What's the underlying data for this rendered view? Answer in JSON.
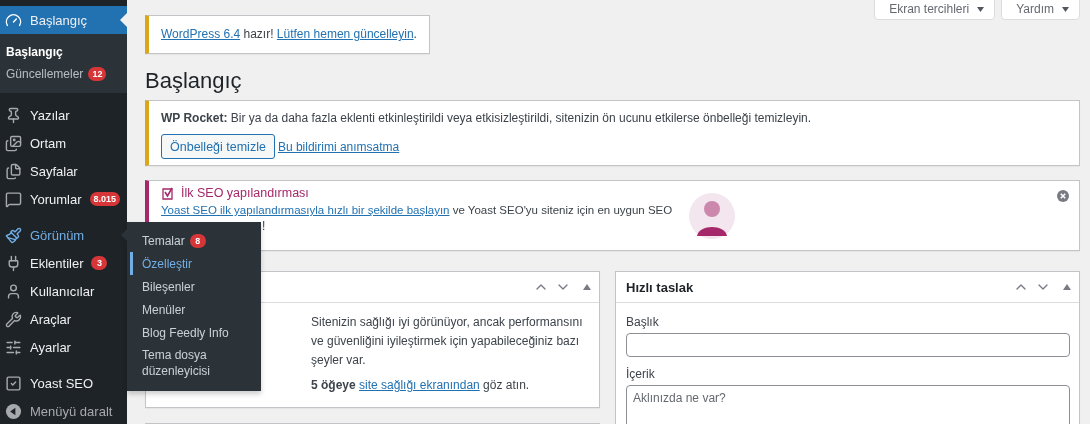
{
  "top_buttons": [
    {
      "label": "Ekran tercihleri"
    },
    {
      "label": "Yardım"
    }
  ],
  "sidebar": {
    "groups": [
      [
        {
          "label": "Başlangıç",
          "selected": true,
          "open": false,
          "submenu": [
            {
              "label": "Başlangıç",
              "selected": true
            },
            {
              "label": "Güncellemeler",
              "badge": "12",
              "selected": false
            }
          ]
        }
      ],
      [
        {
          "label": "Yazılar",
          "selected": false,
          "open": false
        },
        {
          "label": "Ortam",
          "selected": false,
          "open": false
        },
        {
          "label": "Sayfalar",
          "selected": false,
          "open": false
        },
        {
          "label": "Yorumlar",
          "badge": "8.015",
          "selected": false,
          "open": false
        }
      ],
      [
        {
          "label": "Görünüm",
          "selected": false,
          "open": true,
          "submenu": [
            {
              "label": "Temalar",
              "badge": "8",
              "selected": false
            },
            {
              "label": "Özelleştir",
              "selected": true
            },
            {
              "label": "Bileşenler",
              "selected": false
            },
            {
              "label": "Menüler",
              "selected": false
            },
            {
              "label": "Blog Feedly Info",
              "selected": false
            },
            {
              "label": "Tema dosya düzenleyicisi",
              "selected": false
            }
          ]
        },
        {
          "label": "Eklentiler",
          "badge": "3",
          "selected": false,
          "open": false
        },
        {
          "label": "Kullanıcılar",
          "selected": false,
          "open": false
        },
        {
          "label": "Araçlar",
          "selected": false,
          "open": false
        },
        {
          "label": "Ayarlar",
          "selected": false,
          "open": false
        }
      ],
      [
        {
          "label": "Yoast SEO",
          "selected": false,
          "open": false
        }
      ]
    ],
    "collapse_label": "Menüyü daralt"
  },
  "update_notice": {
    "segments": [
      {
        "text": "WordPress 6.4",
        "link": true
      },
      {
        "text": " hazır! ",
        "link": false
      },
      {
        "text": "Lütfen hemen güncelleyin",
        "link": true
      },
      {
        "text": ".",
        "link": false
      }
    ]
  },
  "page_title": "Başlangıç",
  "rocket_notice": {
    "message": "**WP Rocket:** Bir ya da daha fazla eklenti etkinleştirildi veya etkisizleştirildi, sitenizin ön ucunu etkilerse önbelleği temizleyin.",
    "actions": [
      {
        "label": "Önbelleği temizle",
        "kind": "button"
      },
      {
        "label": "Bu bildirimi anımsatma",
        "kind": "link"
      }
    ]
  },
  "yoast_notice": {
    "title": "İlk SEO yapılandırması",
    "segments": [
      {
        "text": "Yoast SEO ilk yapılandırmasıyla hızlı bir şekilde başlayın",
        "link": true
      },
      {
        "text": " ve Yoast SEO'yu siteniz için en uygun SEO",
        "link": false
      }
    ],
    "tail": "!"
  },
  "health_widget": {
    "message": "Sitenizin sağlığı iyi görünüyor, ancak performansını ve güvenliğini iyileştirmek için yapabileceğiniz bazı şeyler var.",
    "segments": [
      {
        "text": "5 öğeye ",
        "bold": true,
        "link": false
      },
      {
        "text": "site sağlığı ekranından",
        "bold": false,
        "link": true
      },
      {
        "text": " göz atın.",
        "bold": false,
        "link": false
      }
    ]
  },
  "quick_draft": {
    "title": "Hızlı taslak",
    "fields": [
      {
        "label": "Başlık",
        "kind": "input"
      },
      {
        "label": "İçerik",
        "kind": "textarea",
        "placeholder": "Aklınızda ne var?"
      }
    ]
  }
}
